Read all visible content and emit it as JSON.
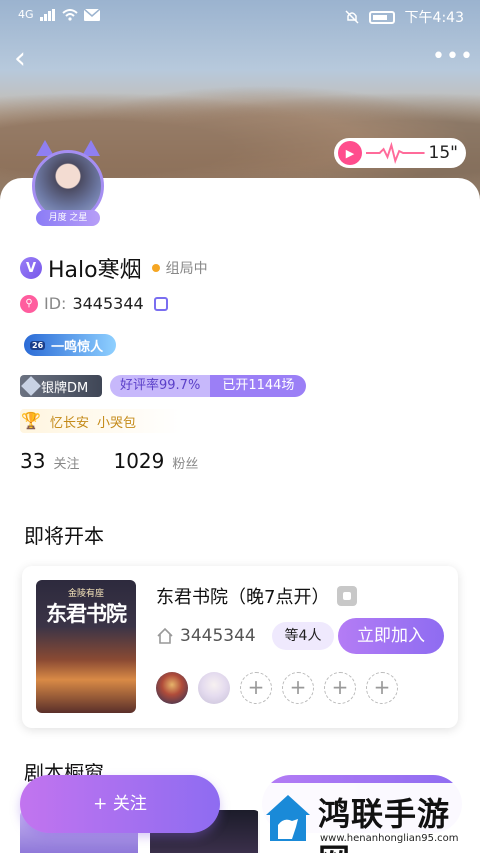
{
  "status_bar": {
    "signal": "4G",
    "time": "下午4:43"
  },
  "nav": {
    "back": "‹",
    "more": "•••"
  },
  "voice": {
    "duration": "15\""
  },
  "avatar": {
    "badge": "月度 之星"
  },
  "profile": {
    "username": "Halo寒烟",
    "status": "组局中",
    "id_label": "ID:",
    "id_value": "3445344",
    "level_badge": "一鸣惊人",
    "level_num": "26",
    "dm_badge": "银牌DM",
    "rating": "好评率99.7%",
    "sessions": "已开1144场",
    "tags": [
      "忆长安",
      "小哭包"
    ],
    "following_count": "33",
    "following_label": "关注",
    "fans_count": "1029",
    "fans_label": "粉丝"
  },
  "upcoming": {
    "section_title": "即将开本",
    "room": {
      "cover_top": "金陵有座",
      "cover_title": "东君书院",
      "title": "东君书院（晚7点开）",
      "room_id": "3445344",
      "waiting": "等4人",
      "join_label": "立即加入",
      "empty_seat": "+"
    }
  },
  "showcase": {
    "section_title": "剧本橱窗"
  },
  "bottom": {
    "follow_label": "+ 关注"
  },
  "watermark": {
    "title": "鸿联手游网",
    "url": "www.henanhonglian95.com"
  },
  "colors": {
    "accent": "#8e6cf1",
    "pink": "#ff4d8d",
    "gold": "#c48a18"
  }
}
